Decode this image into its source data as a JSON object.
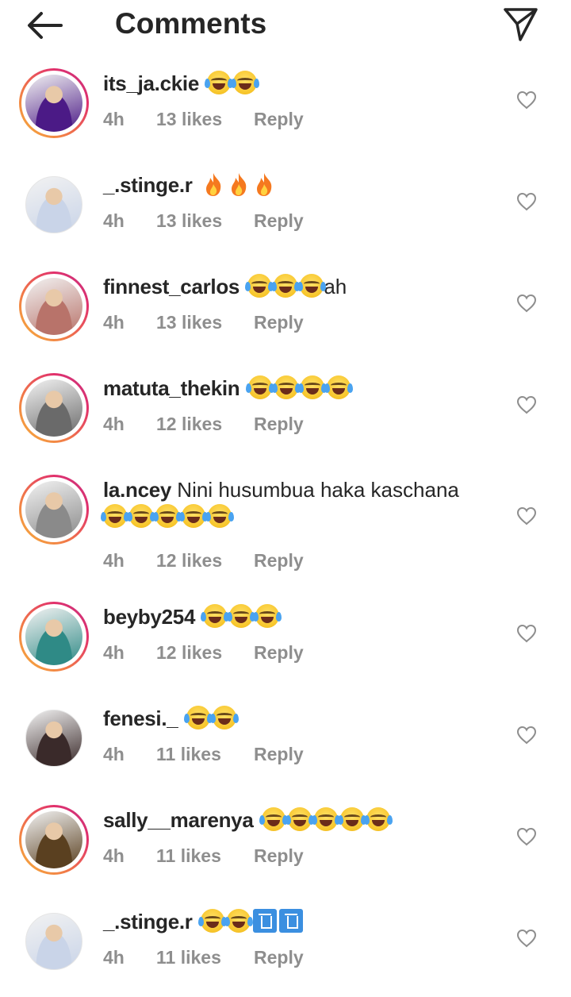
{
  "header": {
    "title": "Comments",
    "back_icon": "arrow-left-icon",
    "send_icon": "paper-plane-icon"
  },
  "comments": [
    {
      "username": "its_ja.ckie",
      "text": "",
      "emojis": [
        "joy",
        "joy"
      ],
      "time": "4h",
      "likes": "13 likes",
      "reply": "Reply",
      "story": true,
      "avatar_color": "#4b1a86"
    },
    {
      "username": "_.stinge.r",
      "text": "",
      "emojis": [
        "fire",
        "fire",
        "fire"
      ],
      "time": "4h",
      "likes": "13 likes",
      "reply": "Reply",
      "story": false,
      "avatar_color": "#c9d4e8"
    },
    {
      "username": "finnest_carlos",
      "text": "",
      "emojis": [
        "joy",
        "joy",
        "joy"
      ],
      "suffix": "ah",
      "time": "4h",
      "likes": "13 likes",
      "reply": "Reply",
      "story": true,
      "avatar_color": "#b8736a"
    },
    {
      "username": "matuta_thekin",
      "text": "",
      "emojis": [
        "joy",
        "joy",
        "joy",
        "joy"
      ],
      "time": "4h",
      "likes": "12 likes",
      "reply": "Reply",
      "story": true,
      "avatar_color": "#6a6a6a"
    },
    {
      "username": "la.ncey",
      "text": "Nini husumbua haka kaschana",
      "emojis": [
        "joy",
        "joy",
        "joy",
        "joy",
        "joy"
      ],
      "time": "4h",
      "likes": "12 likes",
      "reply": "Reply",
      "story": true,
      "avatar_color": "#8a8a8a"
    },
    {
      "username": "beyby254",
      "text": "",
      "emojis": [
        "joy",
        "joy",
        "joy"
      ],
      "time": "4h",
      "likes": "12 likes",
      "reply": "Reply",
      "story": true,
      "avatar_color": "#2f8a86"
    },
    {
      "username": "fenesi._",
      "text": "",
      "emojis": [
        "joy",
        "joy"
      ],
      "time": "4h",
      "likes": "11 likes",
      "reply": "Reply",
      "story": false,
      "avatar_color": "#3a2a2a"
    },
    {
      "username": "sally__marenya",
      "text": "",
      "emojis": [
        "joy",
        "joy",
        "joy",
        "joy",
        "joy"
      ],
      "time": "4h",
      "likes": "11 likes",
      "reply": "Reply",
      "story": true,
      "avatar_color": "#5a4020"
    },
    {
      "username": "_.stinge.r",
      "text": "",
      "emojis": [
        "joy",
        "joy",
        "bin",
        "bin"
      ],
      "time": "4h",
      "likes": "11 likes",
      "reply": "Reply",
      "story": false,
      "avatar_color": "#c9d4e8"
    }
  ]
}
